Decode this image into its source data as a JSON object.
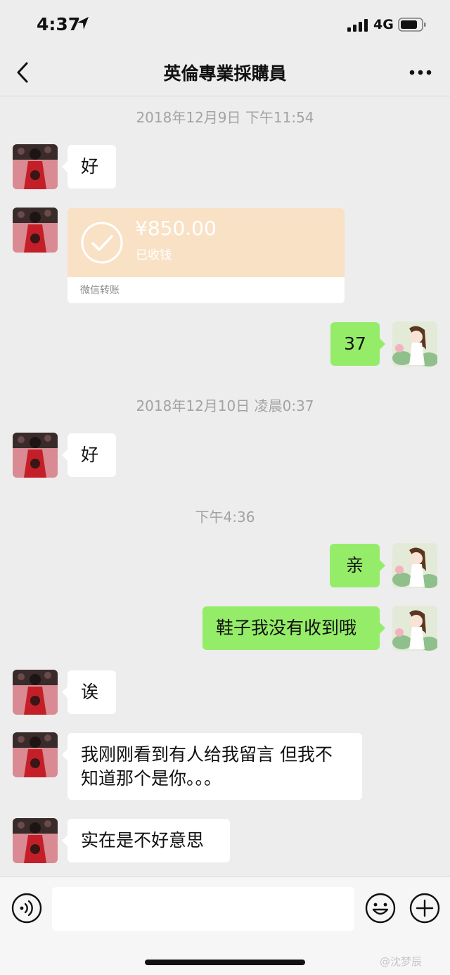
{
  "status_bar": {
    "time": "4:37",
    "network": "4G"
  },
  "header": {
    "title": "英倫專業採購員"
  },
  "messages": {
    "ts1": "2018年12月9日 下午11:54",
    "m1": "好",
    "transfer": {
      "amount": "¥850.00",
      "status": "已收钱",
      "kind": "微信转账"
    },
    "m2": "37",
    "ts2": "2018年12月10日 凌晨0:37",
    "m3": "好",
    "ts3": "下午4:36",
    "m4": "亲",
    "m5": "鞋子我没有收到哦",
    "m6": "诶",
    "m7": "我刚刚看到有人给我留言 但我不知道那个是你。。。",
    "m8": "实在是不好意思"
  },
  "input": {
    "value": ""
  },
  "watermark": "@沈梦辰",
  "colors": {
    "background": "#ededed",
    "green_bubble": "#95ec69",
    "transfer_card": "#f9e1c6"
  }
}
